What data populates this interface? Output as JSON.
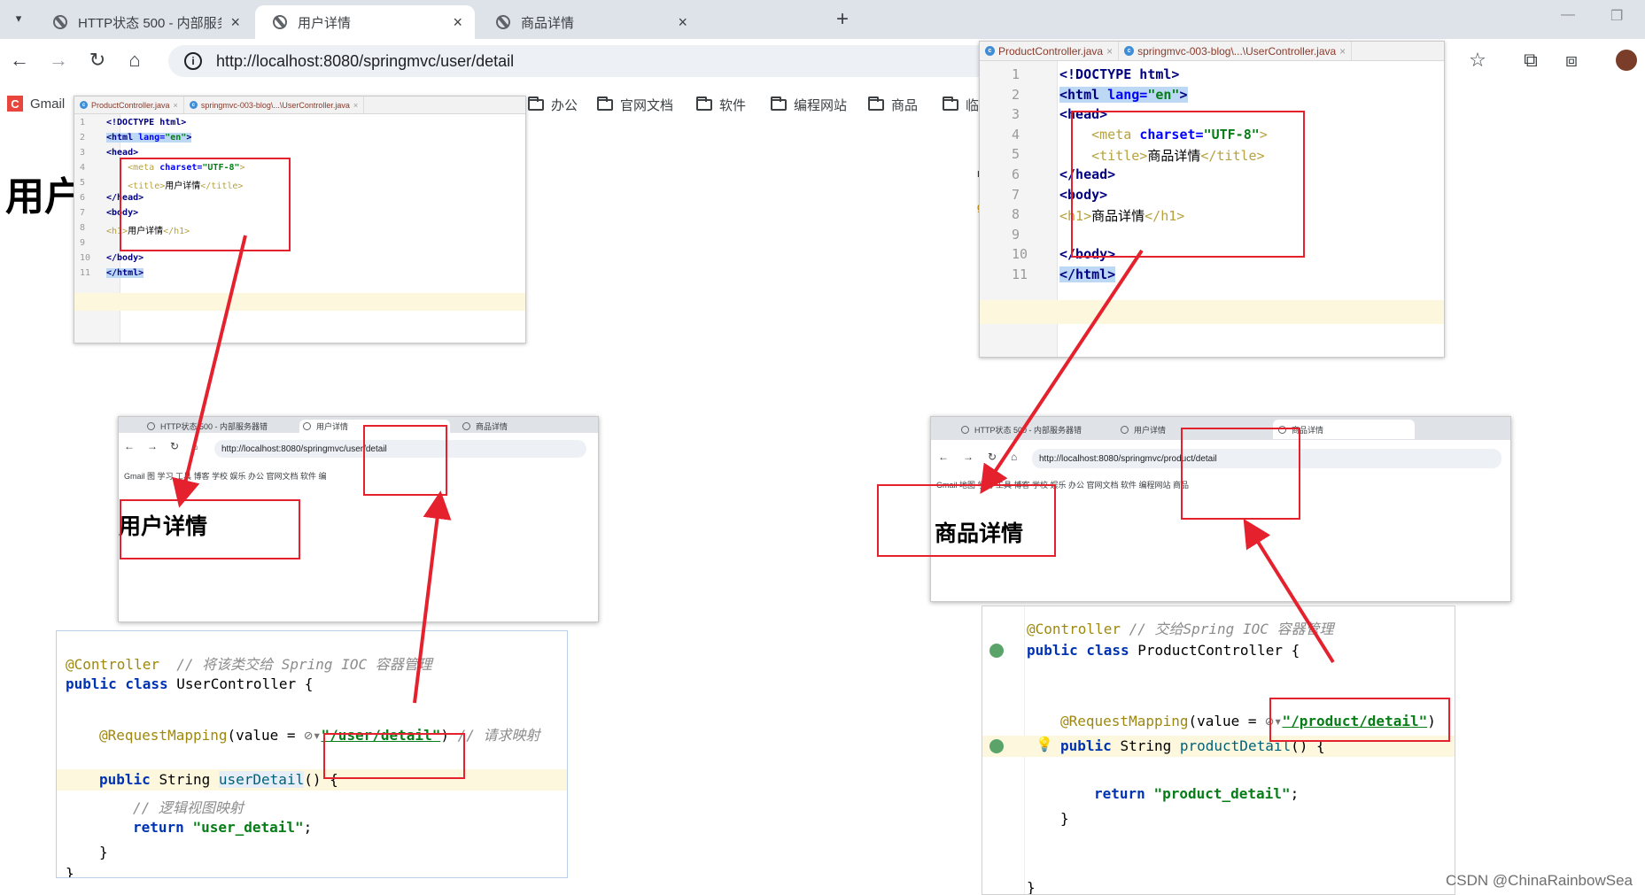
{
  "browser": {
    "menu_icon": "chevron-down-icon",
    "tabs": [
      {
        "label": "HTTP状态 500 - 内部服务器错误",
        "active": false
      },
      {
        "label": "用户详情",
        "active": true
      },
      {
        "label": "商品详情",
        "active": false
      }
    ],
    "new_tab": "+",
    "url": "http://localhost:8080/springmvc/user/detail",
    "bookmarks": [
      {
        "label": "Gmail",
        "icon": "gmail-icon"
      },
      {
        "label": "办公",
        "icon": "folder-icon"
      },
      {
        "label": "官网文档",
        "icon": "folder-icon"
      },
      {
        "label": "软件",
        "icon": "folder-icon"
      },
      {
        "label": "编程网站",
        "icon": "folder-icon"
      },
      {
        "label": "商品",
        "icon": "folder-icon"
      },
      {
        "label": "临",
        "icon": "folder-icon"
      }
    ],
    "page_heading": "用户"
  },
  "ide_left": {
    "file_tabs": [
      "ProductController.java",
      "springmvc-003-blog\\...\\UserController.java"
    ],
    "lines": [
      {
        "n": "1",
        "t": "<!DOCTYPE html>"
      },
      {
        "n": "2",
        "t": "<html lang=\"en\">"
      },
      {
        "n": "3",
        "t": "<head>"
      },
      {
        "n": "4",
        "t": "    <meta charset=\"UTF-8\">"
      },
      {
        "n": "5",
        "t": "    <title>用户详情</title>"
      },
      {
        "n": "6",
        "t": "</head>"
      },
      {
        "n": "7",
        "t": "<body>"
      },
      {
        "n": "8",
        "t": "<h1>用户详情</h1>"
      },
      {
        "n": "9",
        "t": ""
      },
      {
        "n": "10",
        "t": "</body>"
      },
      {
        "n": "11",
        "t": "</html>"
      }
    ]
  },
  "ide_right": {
    "file_tabs": [
      "ProductController.java",
      "springmvc-003-blog\\...\\UserController.java"
    ],
    "side_text": [
      "ntrol",
      "g"
    ],
    "lines": [
      {
        "n": "1",
        "t": "<!DOCTYPE html>"
      },
      {
        "n": "2",
        "t": "<html lang=\"en\">"
      },
      {
        "n": "3",
        "t": "<head>"
      },
      {
        "n": "4",
        "t": "    <meta charset=\"UTF-8\">"
      },
      {
        "n": "5",
        "t": "    <title>商品详情</title>"
      },
      {
        "n": "6",
        "t": "</head>"
      },
      {
        "n": "7",
        "t": "<body>"
      },
      {
        "n": "8",
        "t": "<h1>商品详情</h1>"
      },
      {
        "n": "9",
        "t": ""
      },
      {
        "n": "10",
        "t": "</body>"
      },
      {
        "n": "11",
        "t": "</html>"
      }
    ]
  },
  "mini_left": {
    "tabs": [
      "HTTP状态 500 - 内部服务器错",
      "用户详情",
      "商品详情"
    ],
    "url": "http://localhost:8080/springmvc/user/detail",
    "bookmarks": "Gmail  图  学习  工具  博客  学校  娱乐  办公  官网文档  软件  编",
    "heading": "用户详情"
  },
  "mini_right": {
    "tabs": [
      "HTTP状态 500 - 内部服务器错",
      "用户详情",
      "商品详情"
    ],
    "url": "http://localhost:8080/springmvc/product/detail",
    "bookmarks": "Gmail  地图  学习  工具  博客  学校  娱乐  办公  官网文档  软件  编程网站  商品",
    "heading": "商品详情"
  },
  "java_left": {
    "l1_ann": "@Controller",
    "l1_cmt": "// 将该类交给 Spring IOC 容器管理",
    "l2_kw": "public class",
    "l2_name": "UserController {",
    "l3_ann": "@RequestMapping",
    "l3_pre": "(value = ",
    "l3_str": "\"/user/detail\"",
    "l3_post": ")",
    "l3_cmt": "// 请求映射",
    "l4_kw": "public",
    "l4_type": "String",
    "l4_fn": "userDetail",
    "l4_rest": "() {",
    "l5_cmt": "// 逻辑视图映射",
    "l6_kw": "return",
    "l6_str": "\"user_detail\"",
    "l6_end": ";",
    "l7": "}",
    "l8": "}"
  },
  "java_right": {
    "l1_ann": "@Controller",
    "l1_cmt": "// 交给Spring IOC 容器管理",
    "l2_kw": "public class",
    "l2_name": "ProductController {",
    "l3_ann": "@RequestMapping",
    "l3_pre": "(value = ",
    "l3_str": "\"/product/detail\"",
    "l3_post": ")",
    "l4_kw": "public",
    "l4_type": "String",
    "l4_fn": "productDetail",
    "l4_rest": "() {",
    "l6_kw": "return",
    "l6_str": "\"product_detail\"",
    "l6_end": ";",
    "l7": "}",
    "l8": "}"
  },
  "watermark": "CSDN @ChinaRainbowSea",
  "colors": {
    "highlight_red": "#e5212e",
    "tab_bar": "#dee3ea",
    "tag_blue": "#000080",
    "string_green": "#067d17",
    "annotation": "#9e880d"
  }
}
